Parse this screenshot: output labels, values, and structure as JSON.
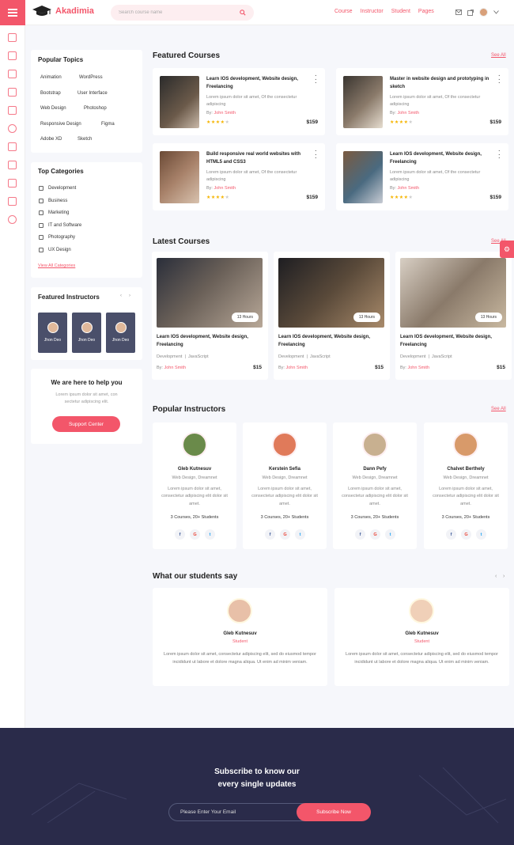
{
  "header": {
    "logo": "Akadimia",
    "search_placeholder": "Search course name",
    "nav": [
      "Course",
      "Instructor",
      "Student",
      "Pages"
    ]
  },
  "sidebar": {
    "popular_topics": {
      "title": "Popular Topics",
      "tags": [
        "Animation",
        "WordPress",
        "Bootstrap",
        "User Interface",
        "Web Design",
        "Photoshop",
        "Responsive Design",
        "Figma",
        "Adobe XD",
        "Sketch"
      ]
    },
    "top_categories": {
      "title": "Top Categories",
      "items": [
        "Development",
        "Business",
        "Marketing",
        "IT and Software",
        "Photography",
        "UX Design"
      ],
      "view_all": "View All Categories"
    },
    "featured_instructors": {
      "title": "Featured Instructors",
      "names": [
        "Jhon Deo",
        "Jhon Deo",
        "Jhon Deo"
      ]
    },
    "help": {
      "title": "We are here to help you",
      "text": "Lorem ipsum dolor sit amet, con sectetur adipiscing elit.",
      "button": "Support Center"
    }
  },
  "featured": {
    "title": "Featured Courses",
    "see_all": "See All",
    "cards": [
      {
        "title": "Learn IOS development, Website design, Freelancing",
        "desc": "Lorem ipsum dolor sit amet, Of the consectetur adipiscing",
        "by": "By:",
        "author": "John Smith",
        "price": "$159",
        "rating": 4
      },
      {
        "title": "Master in website design and prototyping in sketch",
        "desc": "Lorem ipsum dolor sit amet, Of the consectetur adipiscing",
        "by": "By:",
        "author": "John Smith",
        "price": "$159",
        "rating": 4
      },
      {
        "title": "Build responsive real world websites with HTML5 and CSS3",
        "desc": "Lorem ipsum dolor sit amet, Of the consectetur adipiscing",
        "by": "By:",
        "author": "John Smith",
        "price": "$159",
        "rating": 4
      },
      {
        "title": "Learn IOS development, Website design, Freelancing",
        "desc": "Lorem ipsum dolor sit amet, Of the consectetur adipiscing",
        "by": "By:",
        "author": "John Smith",
        "price": "$159",
        "rating": 4
      }
    ]
  },
  "latest": {
    "title": "Latest Courses",
    "see_all": "See All",
    "cards": [
      {
        "hours": "13 Hours",
        "title": "Learn IOS development, Website design, Freelancing",
        "tag1": "Development",
        "tag2": "JavaScript",
        "by": "By:",
        "author": "John Smith",
        "price": "$15"
      },
      {
        "hours": "13 Hours",
        "title": "Learn IOS development, Website design, Freelancing",
        "tag1": "Development",
        "tag2": "JavaScript",
        "by": "By:",
        "author": "John Smith",
        "price": "$15"
      },
      {
        "hours": "13 Hours",
        "title": "Learn IOS development, Website design, Freelancing",
        "tag1": "Development",
        "tag2": "JavaScript",
        "by": "By:",
        "author": "John Smith",
        "price": "$15"
      }
    ]
  },
  "instructors": {
    "title": "Popular Instructors",
    "see_all": "See All",
    "cards": [
      {
        "name": "Gleb Kutnesuv",
        "role": "Web Design, Dreamnet",
        "desc": "Lorem ipsum dolor sit amet, consectetur adipiscing elit dolor sit amet.",
        "stats": "3 Courses, 20+ Students"
      },
      {
        "name": "Kerstein Sefia",
        "role": "Web Design, Dreamnet",
        "desc": "Lorem ipsum dolor sit amet, consectetur adipiscing elit dolor sit amet.",
        "stats": "3 Courses, 20+ Students"
      },
      {
        "name": "Dann Pefy",
        "role": "Web Design, Dreamnet",
        "desc": "Lorem ipsum dolor sit amet, consectetur adipiscing elit dolor sit amet.",
        "stats": "3 Courses, 20+ Students"
      },
      {
        "name": "Chalvet Berthely",
        "role": "Web Design, Dreamnet",
        "desc": "Lorem ipsum dolor sit amet, consectetur adipiscing elit dolor sit amet.",
        "stats": "3 Courses, 20+ Students"
      }
    ],
    "social": [
      "f",
      "G",
      "t"
    ]
  },
  "testimonials": {
    "title": "What our students say",
    "cards": [
      {
        "name": "Gleb Kutnesuv",
        "role": "Student",
        "text": "Lorem ipsum dolor sit amet, consectetur adipiscing elit, sed do eiusmod tempor incididunt ut labore et dolore magna aliqua. Ut enim ad minim veniam."
      },
      {
        "name": "Gleb Kutnesuv",
        "role": "Student",
        "text": "Lorem ipsum dolor sit amet, consectetur adipiscing elit, sed do eiusmod tempor incididunt ut labore et dolore magna aliqua. Ut enim ad minim veniam."
      }
    ]
  },
  "footer": {
    "title1": "Subscribe to know our",
    "title2": "every single updates",
    "email_placeholder": "Please Enter Your Email",
    "button": "Subscribe Now"
  },
  "colors": {
    "accent": "#f3566a",
    "footer": "#2a2b4a"
  }
}
